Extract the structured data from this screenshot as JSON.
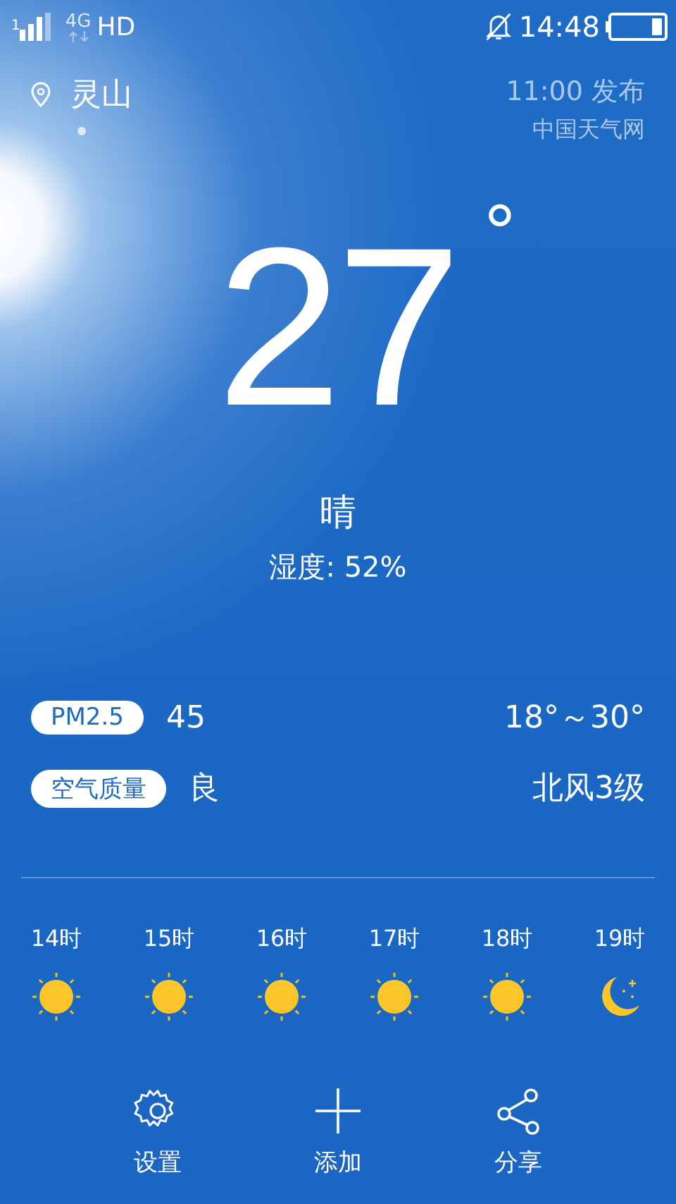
{
  "status_bar": {
    "sim": "1",
    "network": "4G",
    "hd": "HD",
    "time": "14:48",
    "muted": true
  },
  "location": {
    "city": "灵山",
    "pages": [
      {
        "selected": true
      }
    ]
  },
  "publish": {
    "time": "11:00 发布",
    "source": "中国天气网"
  },
  "current": {
    "temperature": "27",
    "degree": "°",
    "condition": "晴",
    "humidity": "湿度: 52%"
  },
  "air": [
    {
      "badge": "PM2.5",
      "value": "45"
    },
    {
      "badge": "空气质量",
      "value": "良"
    }
  ],
  "range": "18°～30°",
  "wind": "北风3级",
  "hourly": [
    {
      "hour": "14时",
      "kind": "sun"
    },
    {
      "hour": "15时",
      "kind": "sun"
    },
    {
      "hour": "16时",
      "kind": "sun"
    },
    {
      "hour": "17时",
      "kind": "sun"
    },
    {
      "hour": "18时",
      "kind": "sun"
    },
    {
      "hour": "19时",
      "kind": "moon"
    }
  ],
  "actions": [
    {
      "label": "设置",
      "kind": "settings"
    },
    {
      "label": "添加",
      "kind": "add"
    },
    {
      "label": "分享",
      "kind": "share"
    }
  ]
}
